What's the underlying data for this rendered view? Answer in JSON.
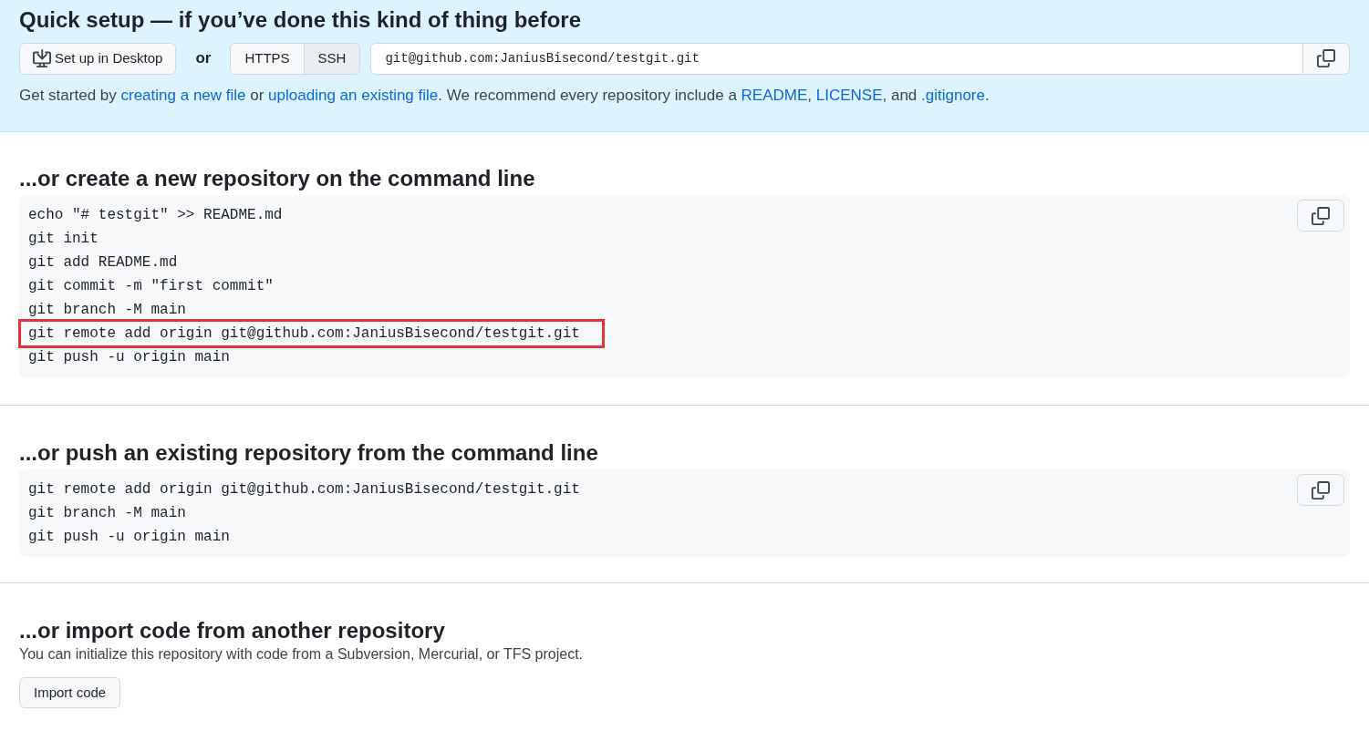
{
  "quick_setup": {
    "title": "Quick setup — if you’ve done this kind of thing before",
    "desktop_button": "Set up in Desktop",
    "or_label": "or",
    "protocols": [
      {
        "label": "HTTPS",
        "selected": false
      },
      {
        "label": "SSH",
        "selected": true
      }
    ],
    "clone_url": "git@github.com:JaniusBisecond/testgit.git",
    "intro": [
      {
        "kind": "text",
        "text": "Get started by "
      },
      {
        "kind": "link",
        "text": "creating a new file"
      },
      {
        "kind": "text",
        "text": " or "
      },
      {
        "kind": "link",
        "text": "uploading an existing file"
      },
      {
        "kind": "text",
        "text": ". We recommend every repository include a "
      },
      {
        "kind": "link",
        "text": "README"
      },
      {
        "kind": "text",
        "text": ", "
      },
      {
        "kind": "link",
        "text": "LICENSE"
      },
      {
        "kind": "text",
        "text": ", and "
      },
      {
        "kind": "link",
        "text": ".gitignore"
      },
      {
        "kind": "text",
        "text": "."
      }
    ]
  },
  "sections": [
    {
      "title": "...or create a new repository on the command line",
      "code": [
        {
          "text": "echo \"# testgit\" >> README.md",
          "highlighted": false
        },
        {
          "text": "git init",
          "highlighted": false
        },
        {
          "text": "git add README.md",
          "highlighted": false
        },
        {
          "text": "git commit -m \"first commit\"",
          "highlighted": false
        },
        {
          "text": "git branch -M main",
          "highlighted": false
        },
        {
          "text": "git remote add origin git@github.com:JaniusBisecond/testgit.git",
          "highlighted": true
        },
        {
          "text": "git push -u origin main",
          "highlighted": false
        }
      ]
    },
    {
      "title": "...or push an existing repository from the command line",
      "code": [
        {
          "text": "git remote add origin git@github.com:JaniusBisecond/testgit.git",
          "highlighted": false
        },
        {
          "text": "git branch -M main",
          "highlighted": false
        },
        {
          "text": "git push -u origin main",
          "highlighted": false
        }
      ]
    }
  ],
  "import": {
    "title": "...or import code from another repository",
    "description": "You can initialize this repository with code from a Subversion, Mercurial, or TFS project.",
    "button": "Import code"
  }
}
